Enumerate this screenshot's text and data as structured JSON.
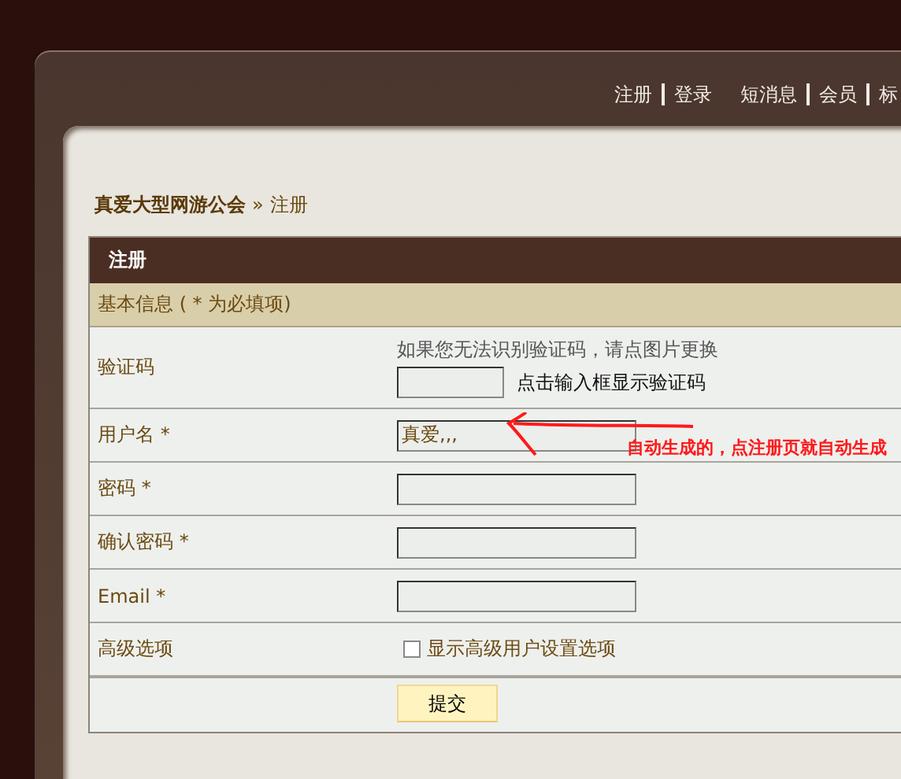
{
  "nav": [
    {
      "label": "注册",
      "divider_before": false
    },
    {
      "label": "登录",
      "divider_before": true
    },
    {
      "label": "短消息",
      "divider_before": false
    },
    {
      "label": "会员",
      "divider_before": true
    },
    {
      "label": "标",
      "divider_before": true
    }
  ],
  "breadcrumb": {
    "site": "真爱大型网游公会",
    "separator": "»",
    "current": "注册"
  },
  "form": {
    "title": "注册",
    "section": "基本信息 ( * 为必填项)",
    "rows": [
      {
        "kind": "captcha",
        "label": "验证码",
        "hint": "如果您无法识别验证码，请点图片更换",
        "note": "点击输入框显示验证码"
      },
      {
        "kind": "text",
        "label": "用户名 *",
        "value": "真爱,,,"
      },
      {
        "kind": "text",
        "label": "密码 *"
      },
      {
        "kind": "text",
        "label": "确认密码 *"
      },
      {
        "kind": "text",
        "label": "Email *"
      },
      {
        "kind": "checkbox",
        "label": "高级选项",
        "option": "显示高级用户设置选项",
        "checked": false
      }
    ],
    "submit": "提交"
  },
  "annotation": {
    "note": "自动生成的，点注册页就自动生成"
  }
}
